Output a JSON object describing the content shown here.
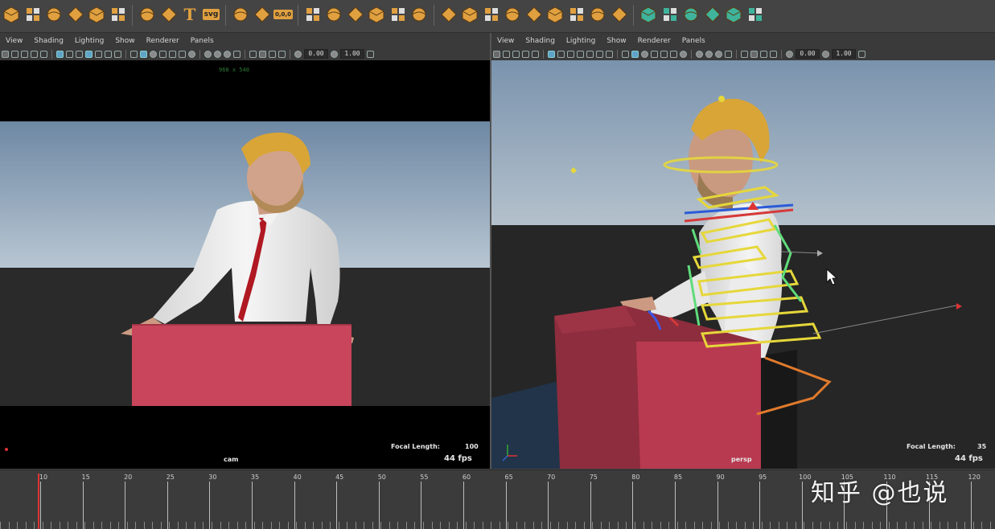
{
  "shelf": {
    "icons": [
      {
        "name": "poly-cube-icon"
      },
      {
        "name": "poly-sphere-icon"
      },
      {
        "name": "poly-cone-icon"
      },
      {
        "name": "poly-torus-icon"
      },
      {
        "name": "poly-plane-icon"
      },
      {
        "name": "poly-disc-icon"
      },
      {
        "name": "platonic-solid-icon"
      },
      {
        "name": "sparkle-icon"
      },
      {
        "name": "type-tool-icon",
        "text": "T"
      },
      {
        "name": "svg-tool-icon",
        "text": "svg"
      },
      {
        "name": "pivot-icon"
      },
      {
        "name": "snap-icon"
      },
      {
        "name": "reset-transform-icon",
        "text": "0,0,0"
      },
      {
        "name": "combine-icon"
      },
      {
        "name": "separate-icon"
      },
      {
        "name": "extract-icon"
      },
      {
        "name": "smooth-icon"
      },
      {
        "name": "boolean-icon"
      },
      {
        "name": "mirror-icon"
      },
      {
        "name": "bevel-icon"
      },
      {
        "name": "extrude-icon"
      },
      {
        "name": "bridge-icon"
      },
      {
        "name": "fill-hole-icon"
      },
      {
        "name": "append-poly-icon"
      },
      {
        "name": "multi-cut-icon"
      },
      {
        "name": "target-weld-icon"
      },
      {
        "name": "edge-loop-icon"
      },
      {
        "name": "quad-draw-icon"
      },
      {
        "name": "uv-editor-icon"
      },
      {
        "name": "uv-planar-icon"
      },
      {
        "name": "uv-auto-icon"
      },
      {
        "name": "uv-unfold-icon"
      },
      {
        "name": "uv-layout-icon"
      },
      {
        "name": "checker-icon"
      }
    ]
  },
  "left_panel": {
    "menus": [
      "View",
      "Shading",
      "Lighting",
      "Show",
      "Renderer",
      "Panels"
    ],
    "field_a": "0.00",
    "field_b": "1.00",
    "resolution": "960 x 540",
    "focal_label": "Focal Length:",
    "focal_value": "100",
    "camera": "cam",
    "fps": "44 fps"
  },
  "right_panel": {
    "menus": [
      "View",
      "Shading",
      "Lighting",
      "Show",
      "Renderer",
      "Panels"
    ],
    "field_a": "0.00",
    "field_b": "1.00",
    "focal_label": "Focal Length:",
    "focal_value": "35",
    "camera": "persp",
    "fps": "44 fps"
  },
  "timeline": {
    "labels": [
      "10",
      "15",
      "20",
      "25",
      "30",
      "35",
      "40",
      "45",
      "50",
      "55",
      "60",
      "65",
      "70",
      "75",
      "80",
      "85",
      "90",
      "95",
      "100",
      "105",
      "110",
      "115",
      "120"
    ],
    "current_frame": 10
  },
  "watermark": "知乎 @也说",
  "colors": {
    "shelf_icon": "#e0a040",
    "shelf_icon_alt": "#3fb39b",
    "podium": "#c8455c",
    "shirt": "#e9e9e9",
    "hair": "#d9a536",
    "tie": "#b01822",
    "sky_top": "#6f8aa7",
    "ground": "#262626"
  }
}
